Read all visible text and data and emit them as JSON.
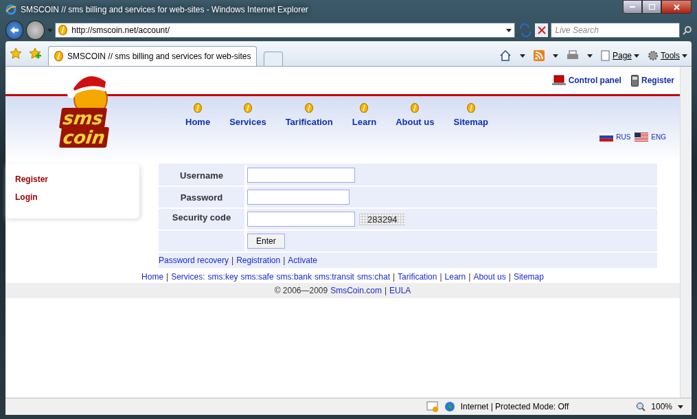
{
  "window": {
    "title": "SMSCOIN // sms billing and services for web-sites - Windows Internet Explorer"
  },
  "address_bar": {
    "url": "http://smscoin.net/account/"
  },
  "search": {
    "placeholder": "Live Search"
  },
  "tabs": [
    {
      "label": "SMSCOIN // sms billing and services for web-sites",
      "selected": true
    }
  ],
  "command_bar": [
    {
      "label": "Page"
    },
    {
      "label": "Tools"
    }
  ],
  "page": {
    "logo": [
      "sms",
      "coin"
    ],
    "top_links": [
      {
        "kind": "panel",
        "label": "Control panel"
      },
      {
        "kind": "register",
        "label": "Register"
      }
    ],
    "nav": [
      "Home",
      "Services",
      "Tarification",
      "Learn",
      "About us",
      "Sitemap"
    ],
    "languages": [
      {
        "code": "RUS",
        "kind": "ru"
      },
      {
        "code": "ENG",
        "kind": "us"
      }
    ],
    "sidebar": [
      "Register",
      "Login"
    ],
    "form": {
      "fields": [
        {
          "label": "Username"
        },
        {
          "label": "Password",
          "kind": "short"
        },
        {
          "label": "Security code",
          "captcha": "283294"
        }
      ],
      "submit": "Enter",
      "separator": "|",
      "links": [
        "Password recovery",
        "Registration",
        "Activate"
      ]
    },
    "footer_links": [
      [
        "Home"
      ],
      [
        "Services:",
        "sms:key",
        "sms:safe",
        "sms:bank",
        "sms:transit",
        "sms:chat"
      ],
      [
        "Tarification"
      ],
      [
        "Learn"
      ],
      [
        "About us"
      ],
      [
        "Sitemap"
      ]
    ],
    "copyright": {
      "text": "© 2006—2009",
      "links": [
        "SmsCoin.com",
        "EULA"
      ]
    }
  },
  "status_bar": {
    "zone": "Internet | Protected Mode: Off",
    "zoom": "100%"
  }
}
